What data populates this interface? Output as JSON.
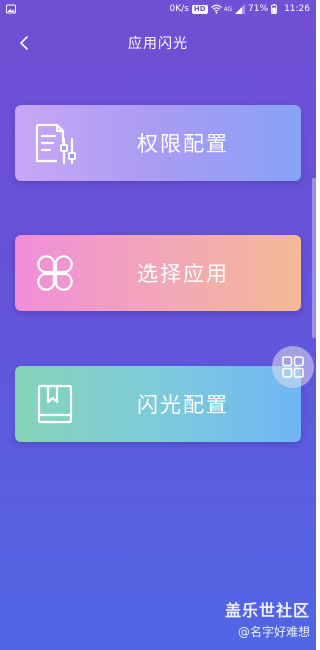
{
  "status_bar": {
    "net_speed": "0K/s",
    "hd": "HD",
    "signal_type": "4G",
    "battery": "71%",
    "time": "11:26"
  },
  "header": {
    "title": "应用闪光"
  },
  "cards": [
    {
      "label": "权限配置",
      "icon": "document-settings-icon"
    },
    {
      "label": "选择应用",
      "icon": "clover-apps-icon"
    },
    {
      "label": "闪光配置",
      "icon": "bookmark-book-icon"
    }
  ],
  "watermark": {
    "line1": "盖乐世社区",
    "line2": "@名字好难想"
  }
}
